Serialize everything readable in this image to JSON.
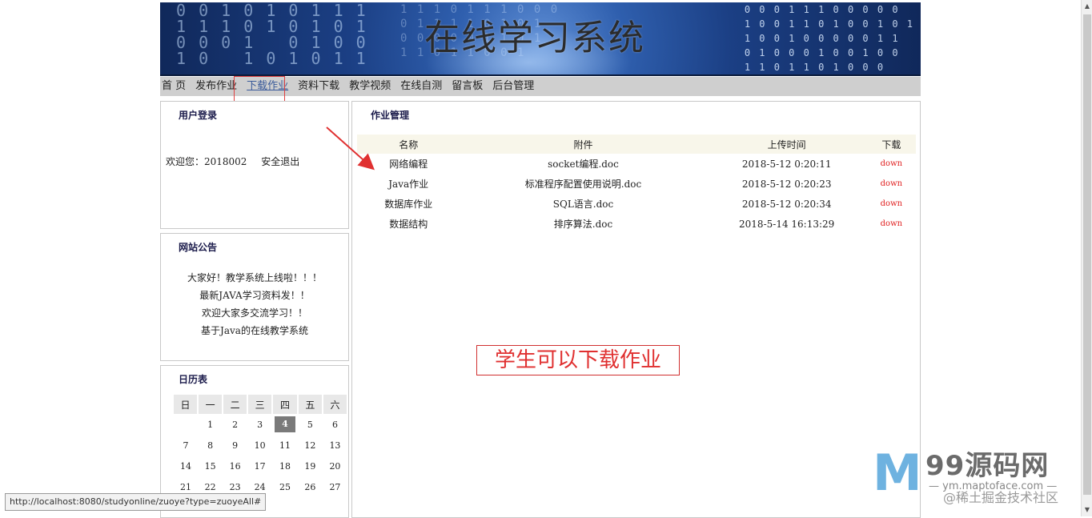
{
  "banner": {
    "title": "在线学习系统",
    "bits_left": "0 0 1 0 1 0 1 1 1\n1 1 1 0 1 0 1 0 1\n0 0 0 1   0 1 0 0\n1 0   1 0 1 0 1 1",
    "bits_mid": "1 1 1 0 1 1 1 0 0 0\n0 1 1 1 1 0 1 0 1\n0 0 0 0 0 1 1 0 1\n1 1 0 1 1 0 0 1",
    "bits_right": "0 0 0 1 1 1 0 0 0 0 0\n1 0 0 1 1 0 1 0 0 1 0 1\n1 0 0 1 0 0 0 0 0 1 1\n0 1 0 0 0 1 0 0 1 0 0\n1 1 0 1 1 0 1 0 0 0"
  },
  "nav": {
    "items": [
      "首 页",
      "发布作业",
      "下载作业",
      "资料下载",
      "教学视频",
      "在线自测",
      "留言板",
      "后台管理"
    ],
    "active_index": 2
  },
  "login": {
    "title": "用户登录",
    "welcome": "欢迎您：2018002",
    "logout": "安全退出"
  },
  "notice": {
    "title": "网站公告",
    "items": [
      "大家好！教学系统上线啦！！！",
      "最新JAVA学习资料发！！",
      "欢迎大家多交流学习！！",
      "基于Java的在线教学系统"
    ]
  },
  "calendar": {
    "title": "日历表",
    "weekdays": [
      "日",
      "一",
      "二",
      "三",
      "四",
      "五",
      "六"
    ],
    "weeks": [
      [
        "",
        "1",
        "2",
        "3",
        "4",
        "5",
        "6"
      ],
      [
        "7",
        "8",
        "9",
        "10",
        "11",
        "12",
        "13"
      ],
      [
        "14",
        "15",
        "16",
        "17",
        "18",
        "19",
        "20"
      ],
      [
        "21",
        "22",
        "23",
        "24",
        "25",
        "26",
        "27"
      ]
    ],
    "today": "4"
  },
  "main": {
    "title": "作业管理",
    "columns": [
      "名称",
      "附件",
      "上传时间",
      "下载"
    ],
    "rows": [
      [
        "网络编程",
        "socket编程.doc",
        "2018-5-12 0:20:11",
        "down"
      ],
      [
        "Java作业",
        "标准程序配置使用说明.doc",
        "2018-5-12 0:20:23",
        "down"
      ],
      [
        "数据库作业",
        "SQL语言.doc",
        "2018-5-12 0:20:34",
        "down"
      ],
      [
        "数据结构",
        "排序算法.doc",
        "2018-5-14 16:13:29",
        "down"
      ]
    ],
    "annotation": "学生可以下载作业"
  },
  "status_url": "http://localhost:8080/studyonline/zuoye?type=zuoyeAll#",
  "watermark": {
    "logo": "M",
    "brand": "99源码网",
    "site": "— ym.maptoface.com —",
    "tag": "@稀土掘金技术社区"
  },
  "colors": {
    "accent_red": "#e03030",
    "nav_bg": "#cfcfcf",
    "banner_blue": "#1b3f84"
  }
}
